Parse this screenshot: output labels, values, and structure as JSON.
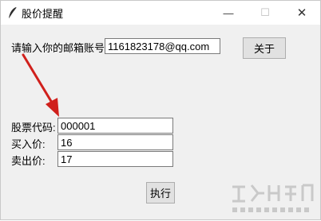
{
  "window": {
    "title": "股价提醒",
    "minimize_glyph": "—",
    "maximize_glyph": "☐",
    "close_glyph": "✕"
  },
  "email": {
    "label": "请输入你的邮箱账号:",
    "value": "1161823178@qq.com"
  },
  "about_button": "关于",
  "stock_code": {
    "label": "股票代码:",
    "value": "000001"
  },
  "buy_price": {
    "label": "买入价:",
    "value": "16"
  },
  "sell_price": {
    "label": "卖出价:",
    "value": "17"
  },
  "execute_button": "执行",
  "colors": {
    "arrow": "#d0201c",
    "watermark": "#c9c9c9"
  },
  "icons": [
    "feather-icon",
    "minimize-icon",
    "maximize-icon",
    "close-icon"
  ]
}
